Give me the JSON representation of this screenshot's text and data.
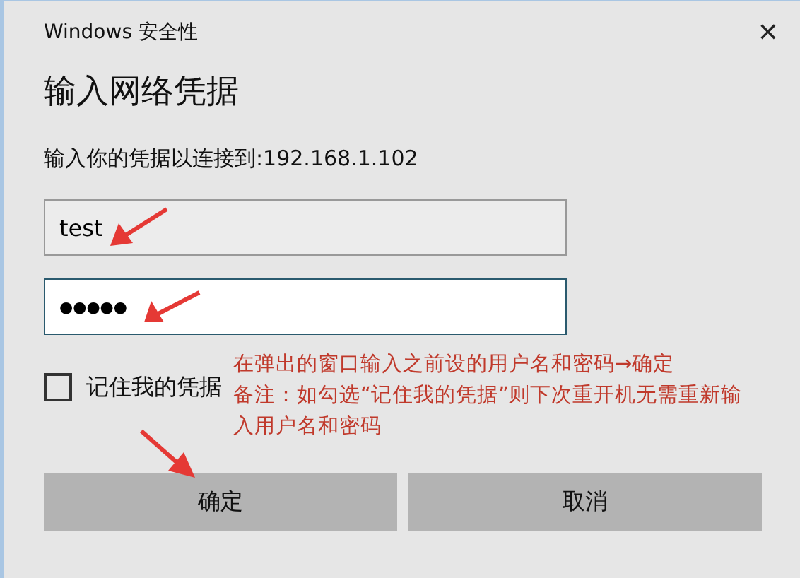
{
  "window": {
    "title": "Windows 安全性",
    "close": "✕"
  },
  "heading": "输入网络凭据",
  "prompt": "输入你的凭据以连接到:192.168.1.102",
  "username": {
    "value": "test"
  },
  "password": {
    "value": "●●●●●"
  },
  "remember": {
    "label": "记住我的凭据",
    "checked": false
  },
  "annotations": [
    "在弹出的窗口输入之前设的用户名和密码→确定",
    "备注：如勾选“记住我的凭据”则下次重开机无需重新输入用户名和密码"
  ],
  "buttons": [
    "确定",
    "取消"
  ]
}
